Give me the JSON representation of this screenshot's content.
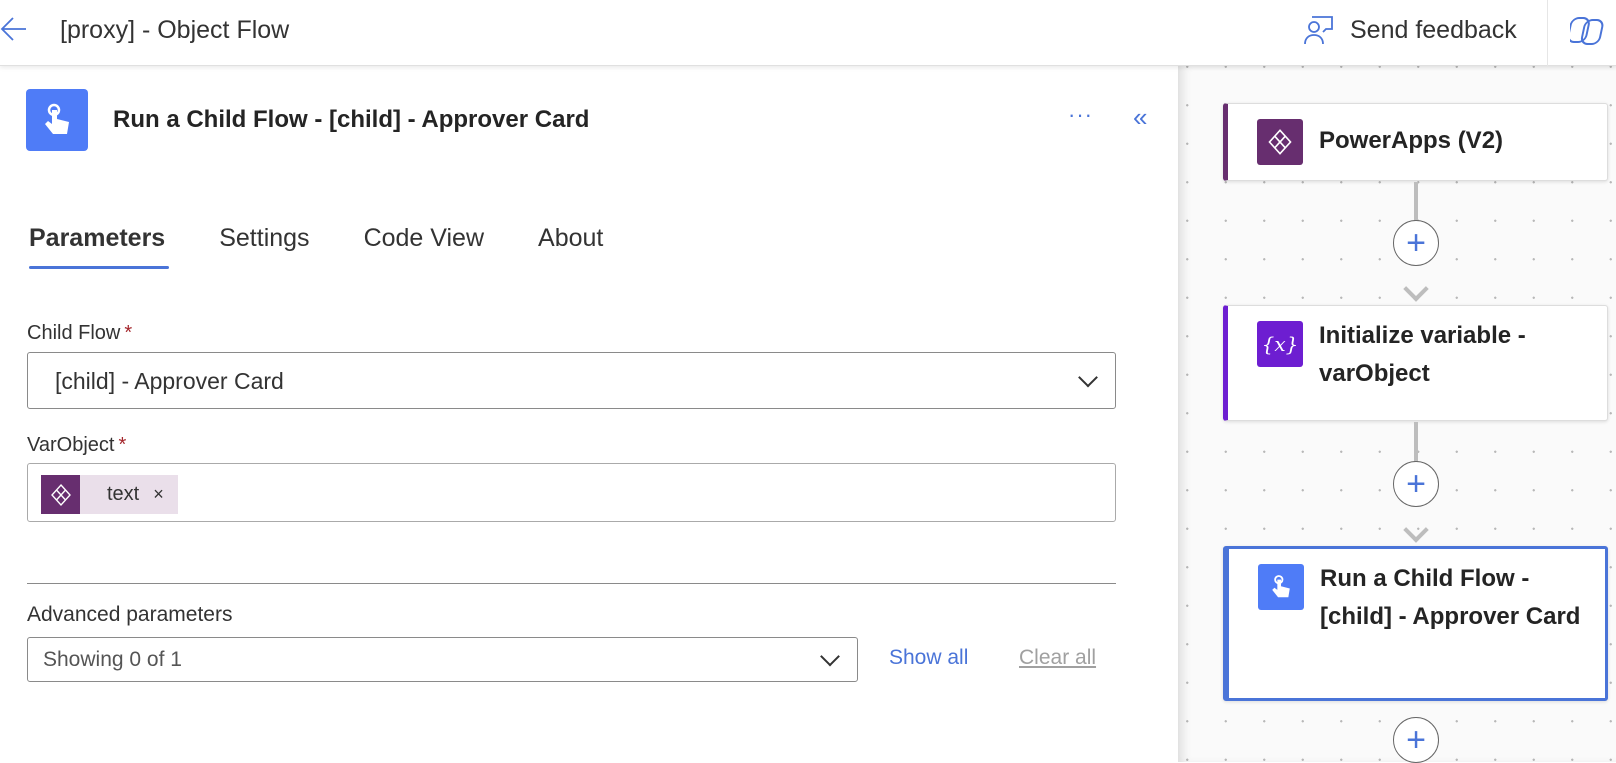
{
  "header": {
    "title": "[proxy] - Object Flow",
    "feedback_label": "Send feedback"
  },
  "panel": {
    "title": "Run a Child Flow - [child] - Approver Card",
    "more_label": "···",
    "tabs": [
      {
        "label": "Parameters"
      },
      {
        "label": "Settings"
      },
      {
        "label": "Code View"
      },
      {
        "label": "About"
      }
    ],
    "child_flow": {
      "label": "Child Flow",
      "required": "*",
      "value": "[child] - Approver Card"
    },
    "var_object": {
      "label": "VarObject",
      "required": "*",
      "token": "text",
      "token_remove": "×"
    },
    "advanced": {
      "label": "Advanced parameters",
      "value": "Showing 0 of 1",
      "show_all": "Show all",
      "clear_all": "Clear all"
    }
  },
  "canvas": {
    "cards": [
      {
        "label": "PowerApps (V2)",
        "accent": "#672e6f"
      },
      {
        "label": "Initialize variable - varObject",
        "accent": "#6d1ed1"
      },
      {
        "label": "Run a Child Flow - [child] - Approver Card",
        "accent": "#4a74d8"
      }
    ],
    "plus_label": "+"
  }
}
